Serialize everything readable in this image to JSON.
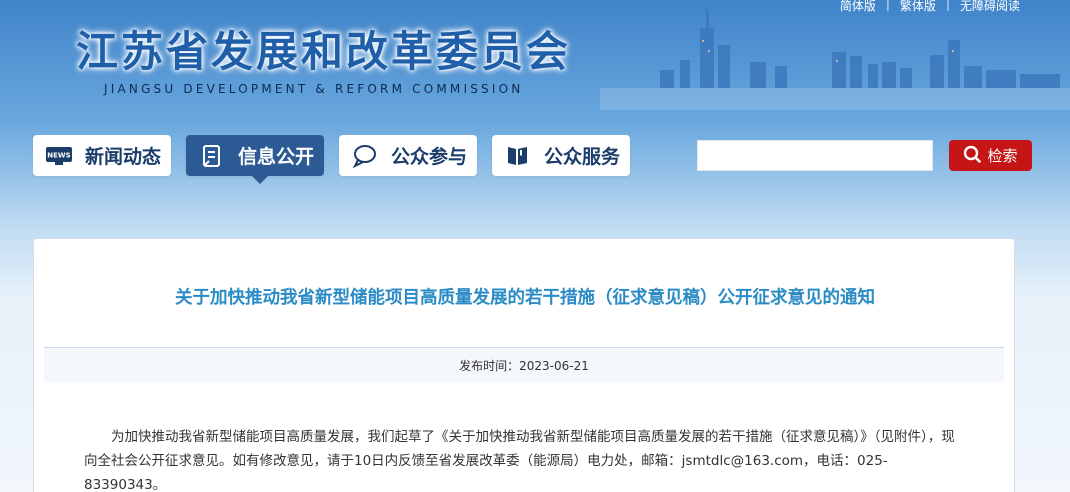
{
  "top_links": [
    "简体版",
    "繁体版",
    "无障碍阅读"
  ],
  "site": {
    "title_cn": "江苏省发展和改革委员会",
    "title_en": "JIANGSU DEVELOPMENT & REFORM COMMISSION"
  },
  "nav": [
    {
      "label": "新闻动态",
      "icon": "news-icon",
      "active": false
    },
    {
      "label": "信息公开",
      "icon": "document-icon",
      "active": true
    },
    {
      "label": "公众参与",
      "icon": "chat-icon",
      "active": false
    },
    {
      "label": "公众服务",
      "icon": "book-icon",
      "active": false
    }
  ],
  "search": {
    "placeholder": "",
    "button_label": "检索",
    "icon": "search-icon"
  },
  "article": {
    "title": "关于加快推动我省新型储能项目高质量发展的若干措施（征求意见稿）公开征求意见的通知",
    "publish_time": "发布时间：2023-06-21",
    "body": "为加快推动我省新型储能项目高质量发展，我们起草了《关于加快推动我省新型储能项目高质量发展的若干措施（征求意见稿）》（见附件），现向全社会公开征求意见。如有修改意见，请于10日内反馈至省发展改革委（能源局）电力处，邮箱：jsmtdlc@163.com，电话：025-83390343。"
  },
  "colors": {
    "accent": "#2a8bc5",
    "nav_active": "#2b5a94",
    "search_button": "#c51516"
  }
}
